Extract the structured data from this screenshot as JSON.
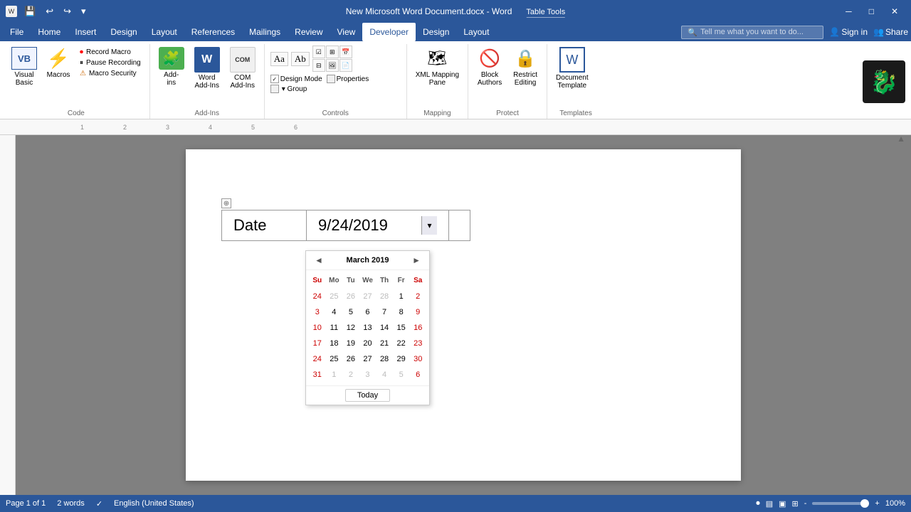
{
  "titleBar": {
    "saveIcon": "💾",
    "undoIcon": "↩",
    "redoIcon": "↪",
    "customizeIcon": "▾",
    "title": "New Microsoft Word Document.docx - Word",
    "tableToolsLabel": "Table Tools",
    "restoreIcon": "⧉",
    "minimizeIcon": "─",
    "maximizeIcon": "□",
    "closeIcon": "✕"
  },
  "menuBar": {
    "items": [
      "File",
      "Home",
      "Insert",
      "Design",
      "Layout",
      "References",
      "Mailings",
      "Review",
      "View",
      "Developer",
      "Design",
      "Layout"
    ],
    "activeItem": "Developer",
    "searchPlaceholder": "Tell me what you want to do...",
    "searchIcon": "🔍",
    "signIn": "Sign in",
    "share": "Share",
    "shareIcon": "👤"
  },
  "ribbon": {
    "groups": [
      {
        "name": "Code",
        "label": "Code",
        "buttons": [
          {
            "id": "visual-basic",
            "label": "Visual\nBasic",
            "type": "large"
          },
          {
            "id": "macros",
            "label": "Macros",
            "type": "large"
          },
          {
            "id": "record-macro",
            "label": "Record Macro",
            "type": "small"
          },
          {
            "id": "pause-recording",
            "label": "Pause Recording",
            "type": "small"
          },
          {
            "id": "macro-security",
            "label": "Macro Security",
            "type": "small"
          }
        ]
      },
      {
        "name": "Add-Ins",
        "label": "Add-Ins",
        "buttons": [
          {
            "id": "add-ins",
            "label": "Add-\nins",
            "type": "large"
          },
          {
            "id": "word-add-ins",
            "label": "Word\nAdd-Ins",
            "type": "large"
          },
          {
            "id": "com-add-ins",
            "label": "COM\nAdd-Ins",
            "type": "large"
          }
        ]
      },
      {
        "name": "Controls",
        "label": "Controls"
      },
      {
        "name": "Mapping",
        "label": "Mapping",
        "buttons": [
          {
            "id": "xml-mapping-pane",
            "label": "XML Mapping\nPane",
            "type": "large"
          }
        ]
      },
      {
        "name": "Protect",
        "label": "Protect",
        "buttons": [
          {
            "id": "block-authors",
            "label": "Block\nAuthors",
            "type": "large"
          },
          {
            "id": "restrict-editing",
            "label": "Restrict\nEditing",
            "type": "large"
          }
        ]
      },
      {
        "name": "Templates",
        "label": "Templates",
        "buttons": [
          {
            "id": "document-template",
            "label": "Document\nTemplate",
            "type": "large"
          }
        ]
      }
    ]
  },
  "document": {
    "table": {
      "dateLabel": "Date",
      "dateValue": "9/24/2019"
    },
    "calendar": {
      "monthYear": "March 2019",
      "prevIcon": "◄",
      "nextIcon": "►",
      "headers": [
        "Su",
        "Mo",
        "Tu",
        "We",
        "Th",
        "Fr",
        "Sa"
      ],
      "weeks": [
        [
          {
            "day": "24",
            "other": true
          },
          {
            "day": "25",
            "other": true
          },
          {
            "day": "26",
            "other": true
          },
          {
            "day": "27",
            "other": true
          },
          {
            "day": "28",
            "other": true
          },
          {
            "day": "1",
            "weekend": false
          },
          {
            "day": "2",
            "weekend": true
          }
        ],
        [
          {
            "day": "3",
            "weekend": true
          },
          {
            "day": "4"
          },
          {
            "day": "5"
          },
          {
            "day": "6"
          },
          {
            "day": "7"
          },
          {
            "day": "8"
          },
          {
            "day": "9",
            "weekend": true
          }
        ],
        [
          {
            "day": "10",
            "weekend": true
          },
          {
            "day": "11"
          },
          {
            "day": "12"
          },
          {
            "day": "13"
          },
          {
            "day": "14"
          },
          {
            "day": "15"
          },
          {
            "day": "16",
            "weekend": true
          }
        ],
        [
          {
            "day": "17",
            "weekend": true
          },
          {
            "day": "18"
          },
          {
            "day": "19"
          },
          {
            "day": "20"
          },
          {
            "day": "21"
          },
          {
            "day": "22"
          },
          {
            "day": "23",
            "weekend": true
          }
        ],
        [
          {
            "day": "24",
            "weekend": true
          },
          {
            "day": "25"
          },
          {
            "day": "26"
          },
          {
            "day": "27"
          },
          {
            "day": "28"
          },
          {
            "day": "29"
          },
          {
            "day": "30",
            "weekend": true
          }
        ],
        [
          {
            "day": "31",
            "weekend": true
          },
          {
            "day": "1",
            "other": true
          },
          {
            "day": "2",
            "other": true
          },
          {
            "day": "3",
            "other": true
          },
          {
            "day": "4",
            "other": true
          },
          {
            "day": "5",
            "other": true
          },
          {
            "day": "6",
            "other": true,
            "weekend": true
          }
        ]
      ],
      "todayLabel": "Today"
    }
  },
  "statusBar": {
    "pageInfo": "Page 1 of 1",
    "wordCount": "2 words",
    "proofingIcon": "✓",
    "language": "English (United States)",
    "macroIcon": "⏺",
    "viewNormal": "▤",
    "viewPrint": "▣",
    "viewWeb": "⊞",
    "zoomOut": "-",
    "zoomLevel": "100%",
    "zoomIn": "+"
  },
  "colors": {
    "wordBlue": "#2b579a",
    "ribbonBg": "#ffffff",
    "docBg": "#808080",
    "pageBg": "#ffffff"
  }
}
